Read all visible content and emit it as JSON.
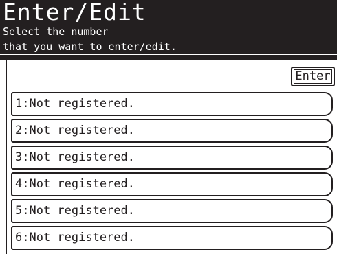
{
  "header": {
    "title": "Enter/Edit",
    "subtitle_line1": "Select the number",
    "subtitle_line2": "that you want to enter/edit."
  },
  "actions": {
    "enter_label": "Enter"
  },
  "entries": [
    {
      "label": "1:Not registered."
    },
    {
      "label": "2:Not registered."
    },
    {
      "label": "3:Not registered."
    },
    {
      "label": "4:Not registered."
    },
    {
      "label": "5:Not registered."
    },
    {
      "label": "6:Not registered."
    }
  ],
  "colors": {
    "header_bg": "#231f20",
    "text": "#231f20",
    "background": "#ffffff"
  }
}
